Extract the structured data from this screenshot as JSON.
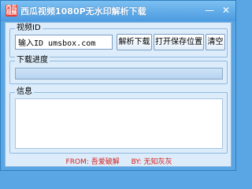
{
  "window": {
    "title": "西瓜视频1080P无水印解析下载",
    "icon_text": [
      "西瓜",
      "视频"
    ],
    "minimize_glyph": "—",
    "close_glyph": "✕"
  },
  "video_id_group": {
    "label": "视频ID",
    "input_value": "输入ID umsbox.com",
    "parse_button": "解析下载",
    "open_folder_button": "打开保存位置",
    "clear_button": "清空"
  },
  "progress_group": {
    "label": "下载进度",
    "progress_percent": 0
  },
  "info_group": {
    "label": "信息",
    "text": ""
  },
  "footer": {
    "from_text": "FROM: 吾爱破解",
    "by_text": "BY: 无知灰灰"
  },
  "colors": {
    "window_bg": "#5aa5e3",
    "client_bg": "#dcecfa",
    "footer_text": "#d61f1f",
    "icon_bg": "#e8382f"
  }
}
